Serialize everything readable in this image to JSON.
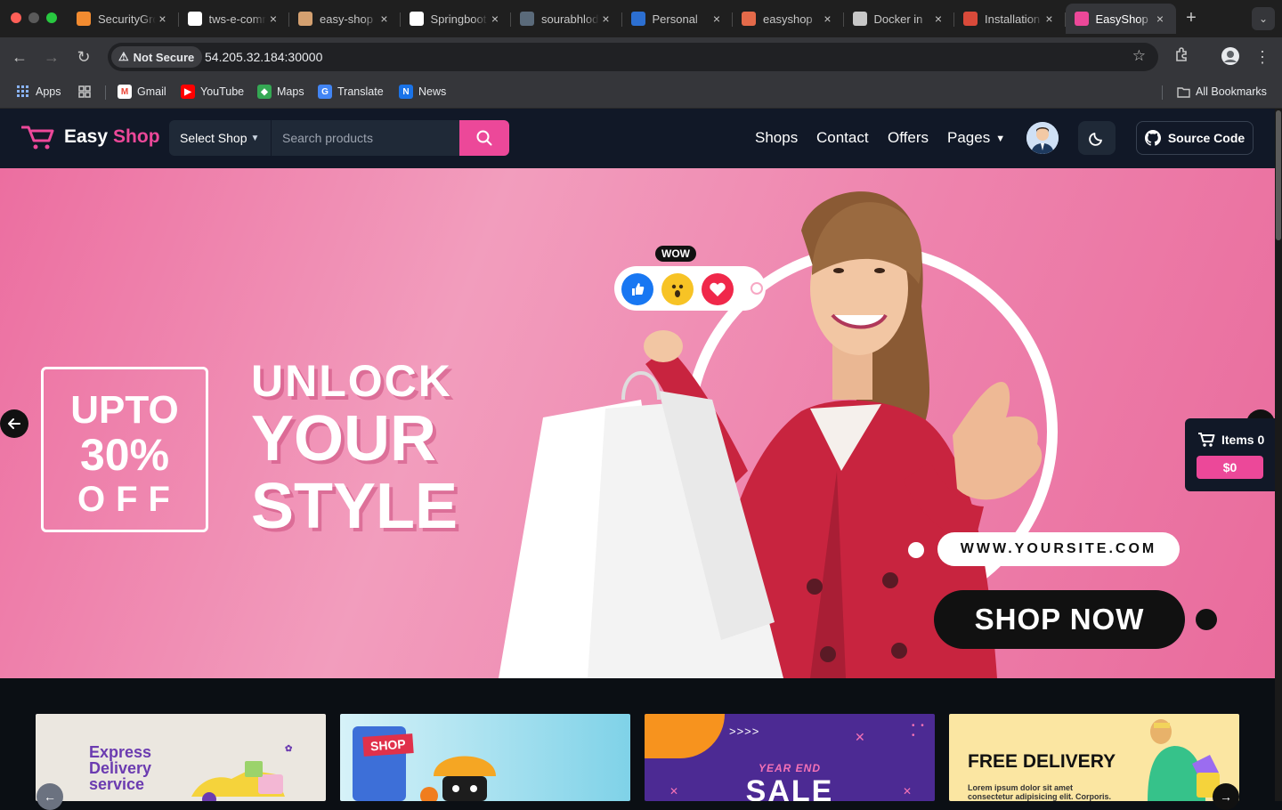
{
  "browser": {
    "tabs": [
      {
        "title": "SecurityGroups",
        "favicon_color": "#f28b30",
        "favicon": "square-orange-icon"
      },
      {
        "title": "tws-e-commerce-app",
        "favicon_color": "#ffffff",
        "favicon": "github-icon"
      },
      {
        "title": "easy-shop",
        "favicon_color": "#d4a070",
        "favicon": "avatar-icon"
      },
      {
        "title": "Springboot",
        "favicon_color": "#ffffff",
        "favicon": "github-icon"
      },
      {
        "title": "sourabhlodhi",
        "favicon_color": "#5a6a7a",
        "favicon": "circle-icon"
      },
      {
        "title": "Personal",
        "favicon_color": "#2c6fd1",
        "favicon": "docker-icon"
      },
      {
        "title": "easyshop",
        "favicon_color": "#e46a4a",
        "favicon": "avatar-icon"
      },
      {
        "title": "Docker in",
        "favicon_color": "#c7c7c7",
        "favicon": "openai-icon"
      },
      {
        "title": "Installation",
        "favicon_color": "#d94a3a",
        "favicon": "jenkins-icon"
      },
      {
        "title": "EasyShop",
        "favicon_color": "#ec4899",
        "favicon": "cart-icon",
        "active": true
      }
    ],
    "security_label": "Not Secure",
    "url": "54.205.32.184:30000",
    "bookmarks": {
      "apps": "Apps",
      "gmail": "Gmail",
      "youtube": "YouTube",
      "maps": "Maps",
      "translate": "Translate",
      "news": "News",
      "all": "All Bookmarks"
    }
  },
  "header": {
    "logo_easy": "Easy",
    "logo_shop": "Shop",
    "select_shop": "Select Shop",
    "search_placeholder": "Search products",
    "nav": {
      "shops": "Shops",
      "contact": "Contact",
      "offers": "Offers",
      "pages": "Pages"
    },
    "source_code": "Source Code"
  },
  "hero": {
    "promo_line1": "UPTO",
    "promo_line2": "30%",
    "promo_line3": "OFF",
    "headline1": "UNLOCK",
    "headline2": "YOUR",
    "headline3": "STYLE",
    "wow": "WOW",
    "website": "WWW.YOURSITE.COM",
    "cta": "SHOP NOW"
  },
  "cart": {
    "items_label": "Items 0",
    "total": "$0"
  },
  "cards": {
    "card1_line1": "Express",
    "card1_line2": "Delivery",
    "card1_line3": "service",
    "card2_badge": "SHOP",
    "card3_arrows": ">>>>",
    "card3_sub": "YEAR END",
    "card3_big": "SALE",
    "card4_title": "FREE DELIVERY",
    "card4_sub1": "Lorem ipsum dolor sit amet",
    "card4_sub2": "consectetur adipisicing elit. Corporis."
  },
  "colors": {
    "accent": "#ec4899",
    "header_bg": "#111827",
    "hero_pink": "#f29dbd"
  }
}
